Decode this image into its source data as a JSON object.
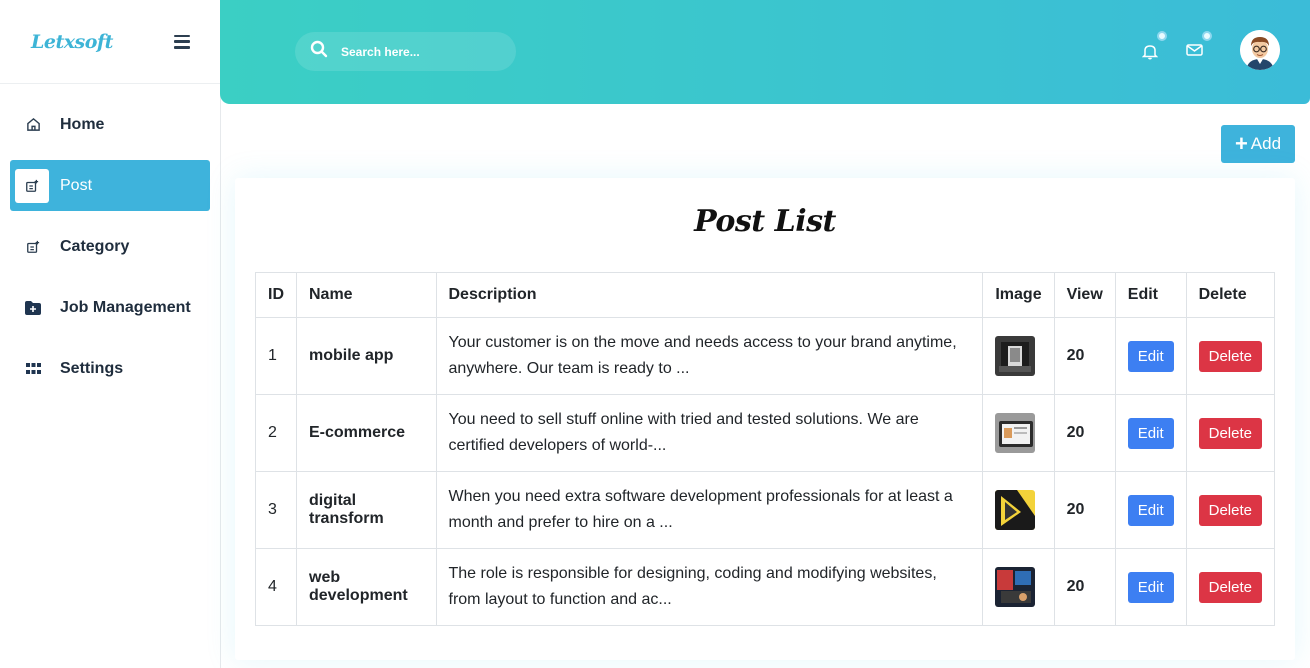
{
  "brand": {
    "logo_text": "Letxsoft"
  },
  "sidebar": {
    "items": [
      {
        "label": "Home",
        "icon": "home-icon",
        "active": false
      },
      {
        "label": "Post",
        "icon": "post-icon",
        "active": true
      },
      {
        "label": "Category",
        "icon": "category-icon",
        "active": false
      },
      {
        "label": "Job Management",
        "icon": "folder-plus-icon",
        "active": false
      },
      {
        "label": "Settings",
        "icon": "grid-icon",
        "active": false
      }
    ]
  },
  "header": {
    "search": {
      "placeholder": "Search here..."
    },
    "icons": [
      "bell-icon",
      "mail-icon"
    ],
    "avatar": "user-avatar"
  },
  "toolbar": {
    "add_label": "Add"
  },
  "page": {
    "title": "Post List"
  },
  "table": {
    "columns": [
      "ID",
      "Name",
      "Description",
      "Image",
      "View",
      "Edit",
      "Delete"
    ],
    "rows": [
      {
        "id": "1",
        "name": "mobile app",
        "description": "Your customer is on the move and needs access to your brand anytime, anywhere. Our team is ready to ...",
        "view": "20",
        "edit": "Edit",
        "delete": "Delete"
      },
      {
        "id": "2",
        "name": "E-commerce",
        "description": "You need to sell stuff online with tried and tested solutions. We are certified developers of world-...",
        "view": "20",
        "edit": "Edit",
        "delete": "Delete"
      },
      {
        "id": "3",
        "name": "digital transform",
        "description": "When you need extra software development professionals for at least a month and prefer to hire on a ...",
        "view": "20",
        "edit": "Edit",
        "delete": "Delete"
      },
      {
        "id": "4",
        "name": "web development",
        "description": "The role is responsible for designing, coding and modifying websites, from layout to function and ac...",
        "view": "20",
        "edit": "Edit",
        "delete": "Delete"
      }
    ]
  },
  "colors": {
    "accent": "#3eb3dc",
    "header_start": "#3bcfc4",
    "header_end": "#3bbcd8",
    "edit": "#3d7ff2",
    "delete": "#dc3545"
  }
}
